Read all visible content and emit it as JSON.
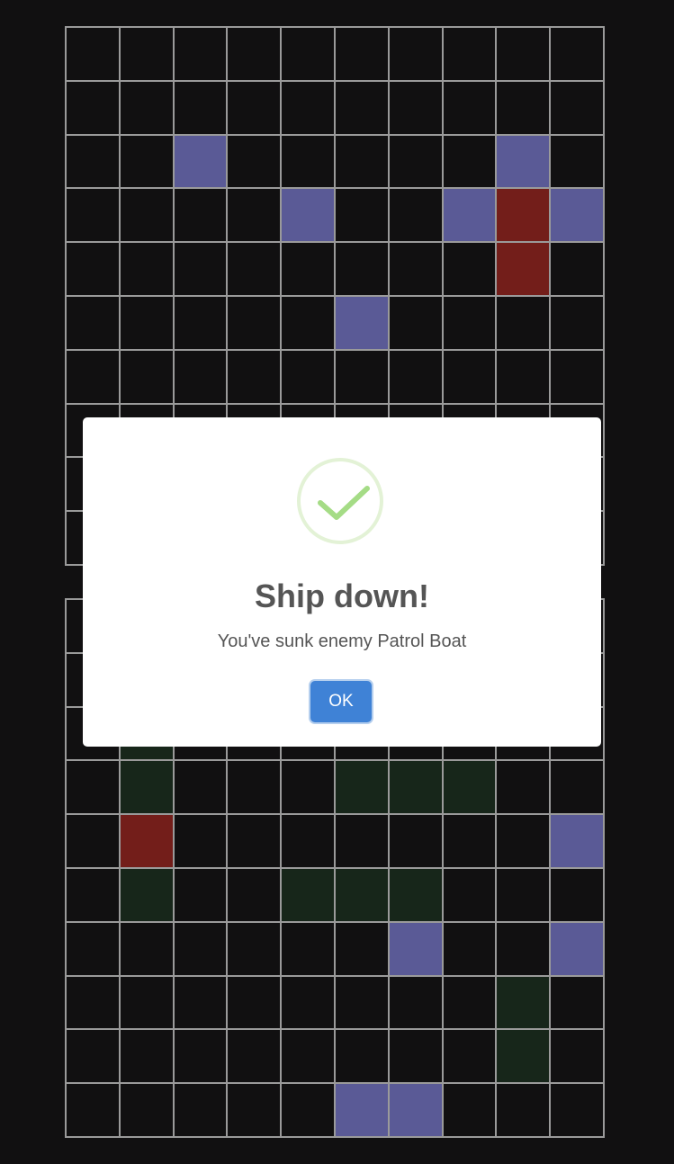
{
  "enemy_board": {
    "size": 10,
    "misses": [
      [
        2,
        2
      ],
      [
        2,
        8
      ],
      [
        3,
        4
      ],
      [
        3,
        7
      ],
      [
        3,
        9
      ],
      [
        5,
        5
      ]
    ],
    "hits": [
      [
        3,
        8
      ],
      [
        4,
        8
      ]
    ],
    "ships": []
  },
  "player_board": {
    "size": 10,
    "ships": [
      [
        2,
        1
      ],
      [
        3,
        1
      ],
      [
        3,
        5
      ],
      [
        3,
        6
      ],
      [
        3,
        7
      ],
      [
        5,
        1
      ],
      [
        5,
        4
      ],
      [
        5,
        5
      ],
      [
        5,
        6
      ],
      [
        7,
        8
      ],
      [
        8,
        8
      ]
    ],
    "hits": [
      [
        4,
        1
      ]
    ],
    "misses": [
      [
        4,
        9
      ],
      [
        6,
        6
      ],
      [
        6,
        9
      ],
      [
        9,
        5
      ],
      [
        9,
        6
      ]
    ]
  },
  "colors": {
    "background": "#111011",
    "grid_line": "#9a9a9a",
    "miss": "#5a5a96",
    "hit": "#731e1a",
    "ship": "#17261a",
    "success_check": "#a5dc86",
    "ok_button": "#3f82d6"
  },
  "modal": {
    "icon": "success-check-icon",
    "title": "Ship down!",
    "message": "You've sunk enemy Patrol Boat",
    "ok_label": "OK"
  }
}
